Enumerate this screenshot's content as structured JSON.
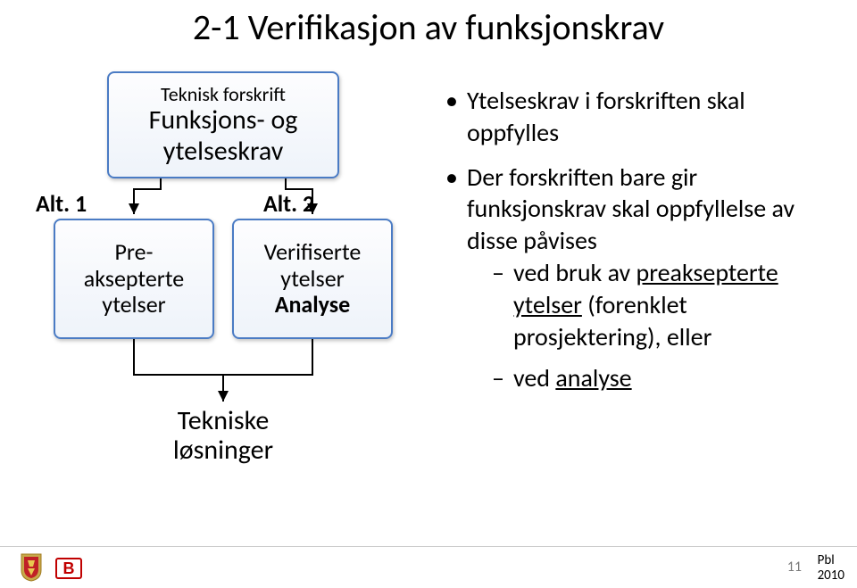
{
  "title": "2-1 Verifikasjon av funksjonskrav",
  "diagram": {
    "top": {
      "line1": "Teknisk forskrift",
      "line2": "Funksjons- og",
      "line3": "ytelseskrav"
    },
    "alt1_label": "Alt. 1",
    "alt2_label": "Alt. 2",
    "left": {
      "line1": "Pre-",
      "line2": "aksepterte",
      "line3": "ytelser"
    },
    "right": {
      "line1": "Verifiserte",
      "line2": "ytelser",
      "line3": "Analyse"
    },
    "bottom": {
      "line1": "Tekniske",
      "line2": "løsninger"
    }
  },
  "bullets": {
    "b1": "Ytelseskrav i forskriften skal oppfylles",
    "b2": "Der forskriften bare gir funksjonskrav skal oppfyllelse av disse påvises",
    "sub1_pre": "ved bruk av ",
    "sub1_u": "preaksepterte ytelser",
    "sub1_post": " (forenklet prosjektering), eller",
    "sub2_pre": "ved ",
    "sub2_u": "analyse"
  },
  "footer": {
    "page": "11",
    "pbl_line1": "Pbl",
    "pbl_line2": "2010",
    "logo_b": "B"
  }
}
